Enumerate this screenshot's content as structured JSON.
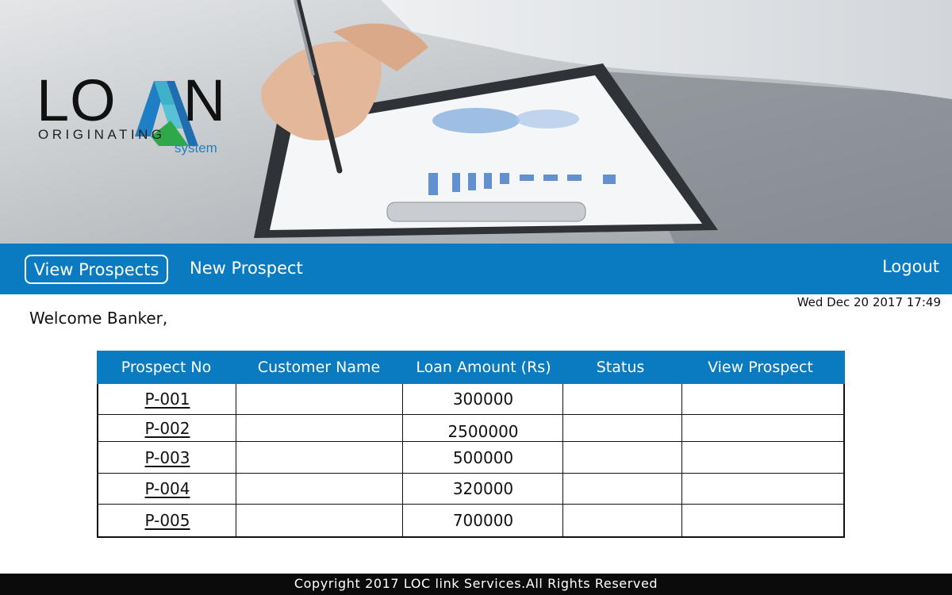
{
  "brand": {
    "logo_word_left": "LO",
    "logo_word_right": "N",
    "logo_sub": "ORIGINATING",
    "logo_system": "system",
    "colors": {
      "blue": "#1f7fc4",
      "green": "#2ea84a",
      "teal": "#3fb1c9"
    }
  },
  "nav": {
    "view_prospects": "View Prospects",
    "new_prospect": "New Prospect",
    "logout": "Logout",
    "bar_color": "#0a7bc1"
  },
  "datetime": "Wed Dec 20 2017 17:49",
  "welcome": "Welcome Banker,",
  "table": {
    "columns": [
      "Prospect No",
      "Customer Name",
      "Loan Amount (Rs)",
      "Status",
      "View Prospect"
    ],
    "rows": [
      {
        "prospect_no": "P-001",
        "customer_name": "",
        "loan_amount": "300000",
        "status": "",
        "view": ""
      },
      {
        "prospect_no": "P-002",
        "customer_name": "",
        "loan_amount": "2500000",
        "status": "",
        "view": ""
      },
      {
        "prospect_no": "P-003",
        "customer_name": "",
        "loan_amount": "500000",
        "status": "",
        "view": ""
      },
      {
        "prospect_no": "P-004",
        "customer_name": "",
        "loan_amount": "320000",
        "status": "",
        "view": ""
      },
      {
        "prospect_no": "P-005",
        "customer_name": "",
        "loan_amount": "700000",
        "status": "",
        "view": ""
      }
    ]
  },
  "footer": "Copyright 2017 LOC link Services.All Rights Reserved"
}
